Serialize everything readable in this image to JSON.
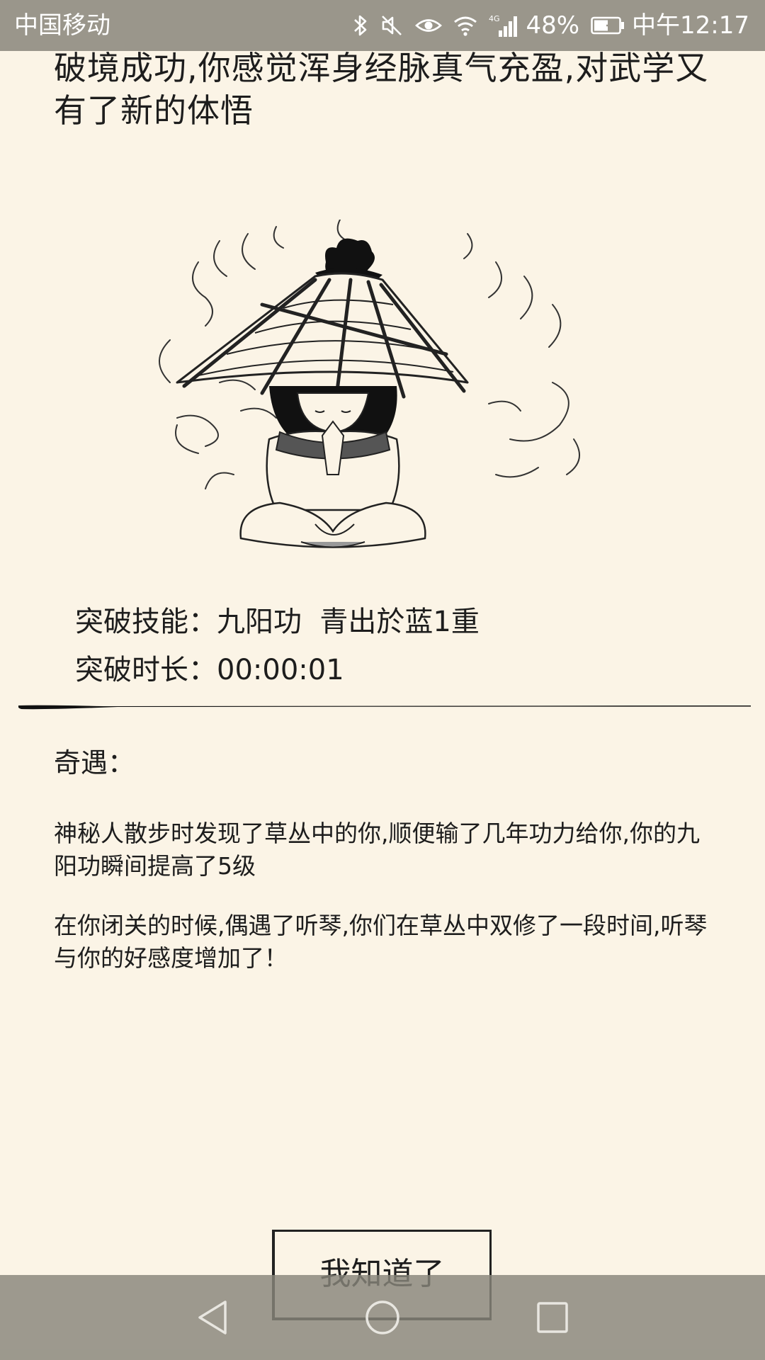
{
  "status_bar": {
    "carrier": "中国移动",
    "network": "4G",
    "battery": "48%",
    "time": "中午12:17",
    "icons": [
      "bluetooth-icon",
      "mute-icon",
      "eye-icon",
      "wifi-icon",
      "signal-icon",
      "battery-charging-icon"
    ]
  },
  "headline": "破境成功,你感觉浑身经脉真气充盈,对武学又有了新的体悟",
  "illustration": "meditating-martial-artist-with-straw-hat",
  "breakthrough": {
    "skill_label": "突破技能：",
    "skill_value": "九阳功  青出於蓝1重",
    "duration_label": "突破时长：",
    "duration_value": "00:00:01"
  },
  "encounter": {
    "title": "奇遇：",
    "events": [
      "神秘人散步时发现了草丛中的你,顺便输了几年功力给你,你的九阳功瞬间提高了5级",
      "在你闭关的时候,偶遇了听琴,你们在草丛中双修了一段时间,听琴与你的好感度增加了！"
    ]
  },
  "button_label": "我知道了",
  "nav": {
    "icons": [
      "back-icon",
      "home-icon",
      "recent-apps-icon"
    ]
  }
}
